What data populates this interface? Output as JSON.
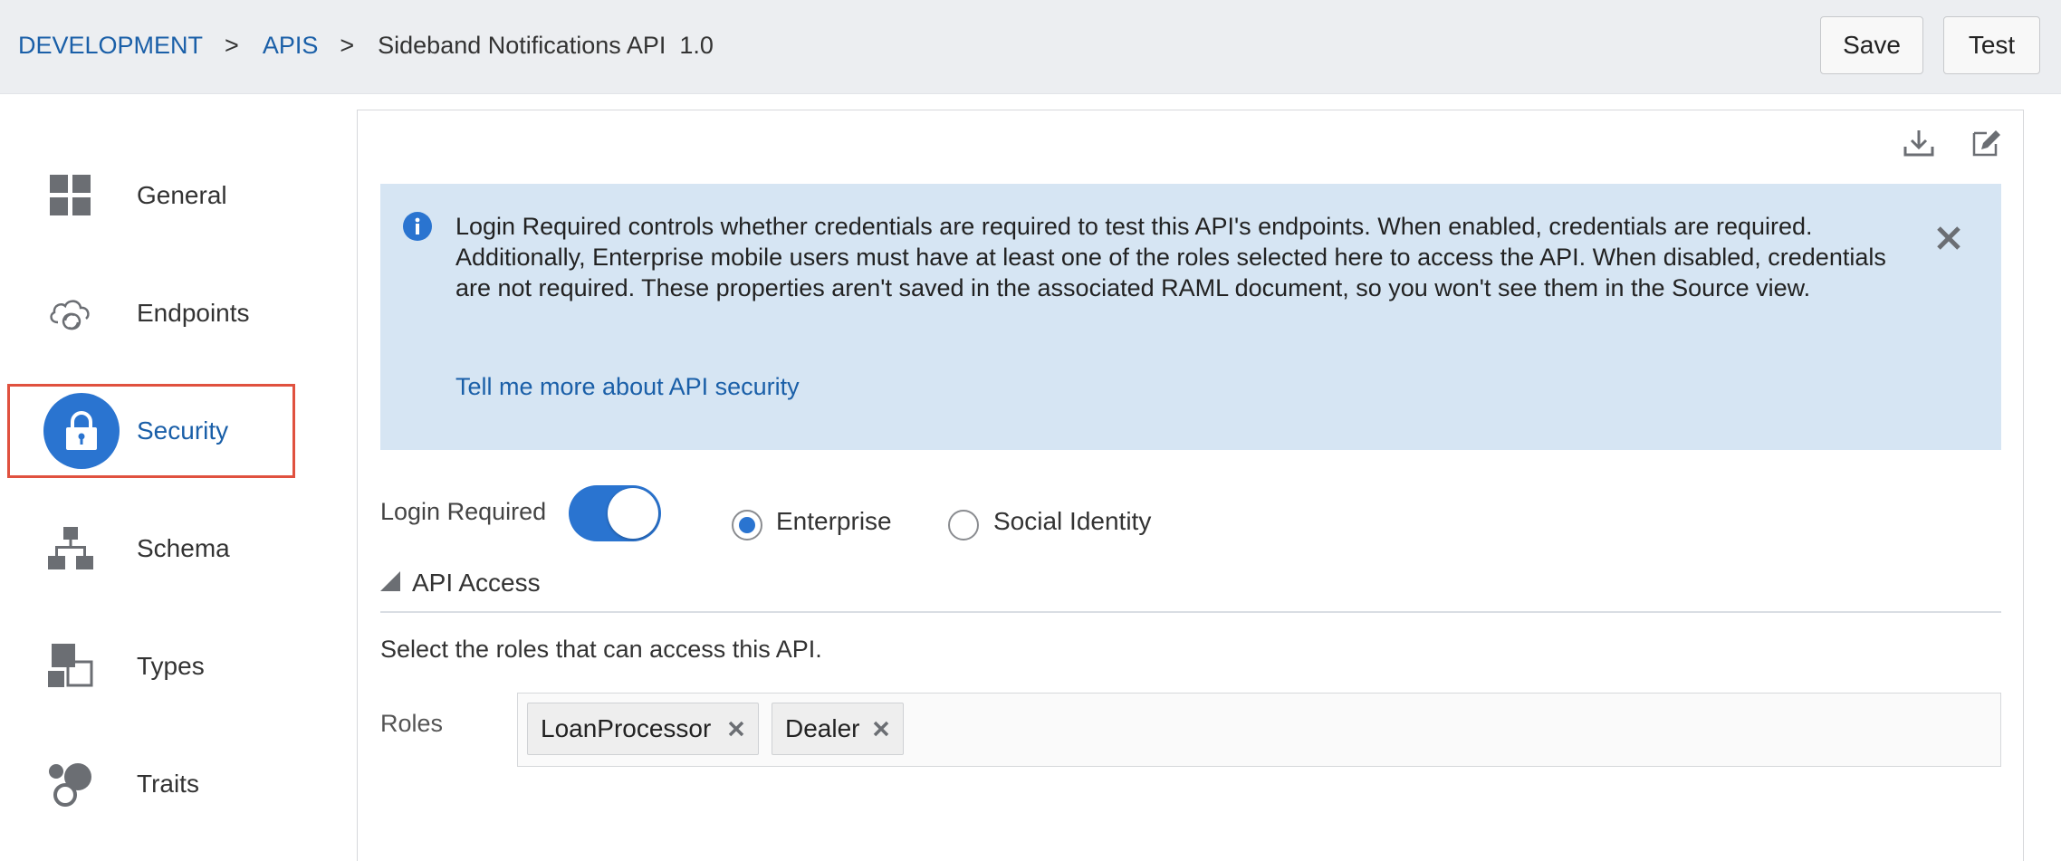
{
  "breadcrumb": {
    "items": [
      "DEVELOPMENT",
      "APIS"
    ],
    "separator": ">",
    "current": "Sideband Notifications API  1.0"
  },
  "header": {
    "save_label": "Save",
    "test_label": "Test"
  },
  "sidebar": {
    "items": [
      {
        "label": "General",
        "icon": "grid-icon"
      },
      {
        "label": "Endpoints",
        "icon": "cloud-sync-icon"
      },
      {
        "label": "Security",
        "icon": "lock-icon",
        "active": true
      },
      {
        "label": "Schema",
        "icon": "hierarchy-icon"
      },
      {
        "label": "Types",
        "icon": "shapes-icon"
      },
      {
        "label": "Traits",
        "icon": "circles-icon"
      }
    ]
  },
  "toolbar": {
    "download_icon": "download-icon",
    "edit_icon": "edit-icon"
  },
  "info": {
    "text": "Login Required controls whether credentials are required to test this API's endpoints. When enabled, credentials are required. Additionally, Enterprise mobile users must have at least one of the roles selected here to access the API. When disabled, credentials are not required. These properties aren't saved in the associated RAML document, so you won't see them in the Source view.",
    "link": "Tell me more about API security"
  },
  "login": {
    "label": "Login Required",
    "enabled": true,
    "options": [
      "Enterprise",
      "Social Identity"
    ],
    "selected": "Enterprise"
  },
  "api_access": {
    "title": "API Access",
    "description": "Select the roles that can access this API.",
    "roles_label": "Roles",
    "roles": [
      "LoanProcessor",
      "Dealer"
    ]
  },
  "colors": {
    "accent": "#2a74d0",
    "link": "#1a5fa8",
    "info_bg": "#d6e5f3",
    "highlight_border": "#e0513f",
    "header_bg": "#eceef1"
  }
}
